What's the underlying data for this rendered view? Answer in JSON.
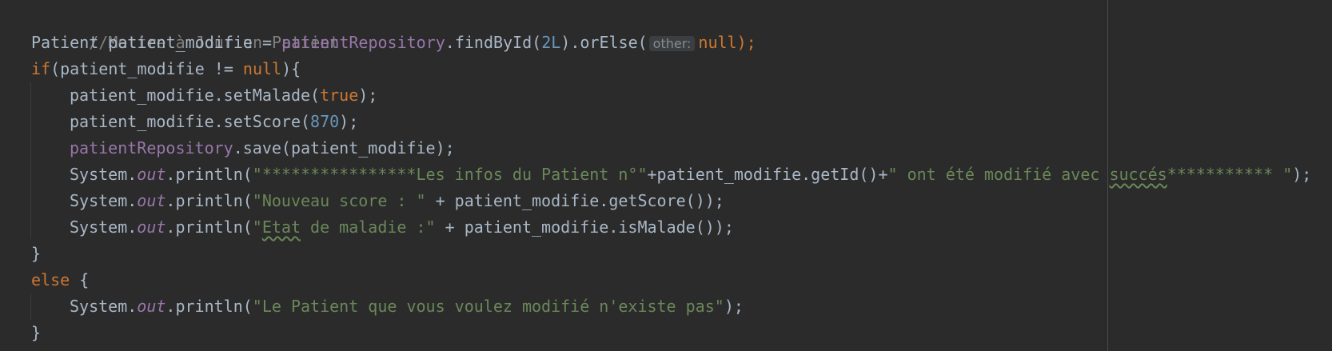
{
  "editor": {
    "lines": [
      {
        "comment": "//Mettre à Jour un Patient"
      },
      {
        "type_decl": "Patient patient_modifie = ",
        "repo": "patientRepository",
        "call": ".findById(",
        "id_num": "2L",
        "call2": ").orElse(",
        "hint": "other:",
        "null_kw": "null",
        "close": ");"
      },
      {
        "if_kw": "if",
        "cond_open": "(patient_modifie != ",
        "null_kw": "null",
        "cond_close": "){"
      },
      {
        "call": "patient_modifie.setMalade(",
        "true_kw": "true",
        "close": ");"
      },
      {
        "call": "patient_modifie.setScore(",
        "score_num": "870",
        "close": ");"
      },
      {
        "repo": "patientRepository",
        "call": ".save(patient_modifie);"
      },
      {
        "sys": "System.",
        "out": "out",
        "println": ".println(",
        "str1": "\"****************Les infos du Patient n°\"",
        "concat1": "+patient_modifie.getId()+",
        "str2a": "\" ont été modifié avec ",
        "str2b": "succés",
        "str2c": "*********** \"",
        "close": ");"
      },
      {
        "sys": "System.",
        "out": "out",
        "println": ".println(",
        "str": "\"Nouveau score : \"",
        "rest": " + patient_modifie.getScore());"
      },
      {
        "sys": "System.",
        "out": "out",
        "println": ".println(",
        "str_q": "\"",
        "str_typo": "Etat",
        "str_rest": " de maladie :\"",
        "rest": " + patient_modifie.isMalade());"
      },
      {
        "brace": "}"
      },
      {
        "else_kw": "else",
        "brace": " {"
      },
      {
        "sys": "System.",
        "out": "out",
        "println": ".println(",
        "str": "\"Le Patient que vous voulez modifié n'existe pas\"",
        "close": ");"
      },
      {
        "brace": "}"
      }
    ]
  }
}
